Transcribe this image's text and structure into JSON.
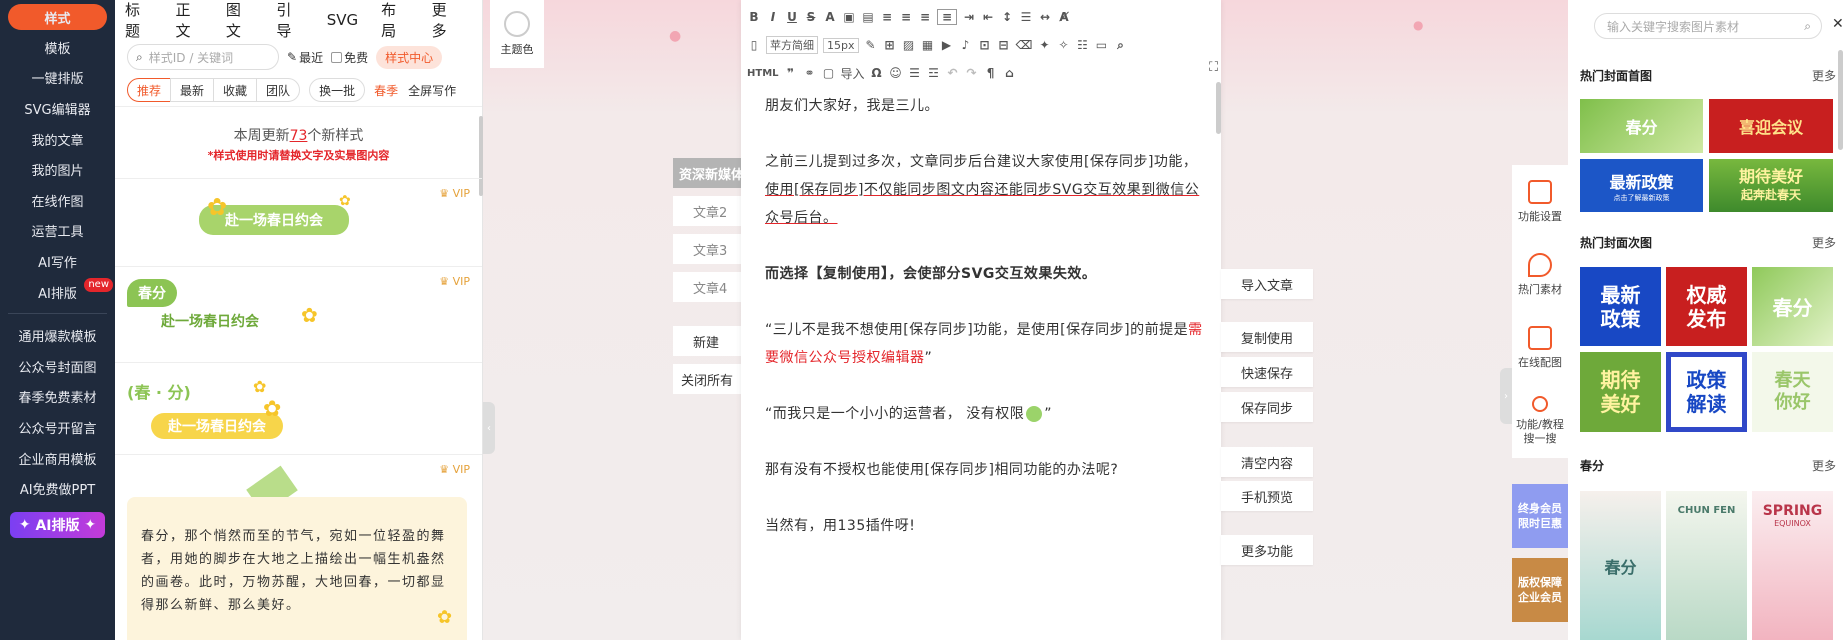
{
  "nav": {
    "items": [
      "样式",
      "模板",
      "一键排版",
      "SVG编辑器",
      "我的文章",
      "我的图片",
      "在线作图",
      "运营工具",
      "AI写作",
      "AI排版"
    ],
    "new_badge": "new",
    "items2": [
      "通用爆款模板",
      "公众号封面图",
      "春季免费素材",
      "公众号开留言",
      "企业商用模板",
      "AI免费做PPT"
    ],
    "ai_button": "AI排版"
  },
  "panel": {
    "tabs": [
      "标题",
      "正文",
      "图文",
      "引导",
      "SVG",
      "布局",
      "更多"
    ],
    "search_placeholder": "样式ID / 关键词",
    "recent": "最近",
    "free": "免费",
    "center": "样式中心",
    "filters": [
      "推荐",
      "最新",
      "收藏",
      "团队"
    ],
    "refresh": "换一批",
    "spring": "春季",
    "fullscreen": "全屏写作",
    "update_prefix": "本周更新",
    "update_count": "73",
    "update_suffix": "个新样式",
    "update_note": "*样式使用时请替换文字及实景图内容",
    "vip": "VIP",
    "card1_text": "赴一场春日约会",
    "card2_badge": "春分",
    "card2_text": "赴一场春日约会",
    "card3_title": "(春 · 分)",
    "card3_text": "赴一场春日约会",
    "card4_text": "春分，那个悄然而至的节气，宛如一位轻盈的舞者，用她的脚步在大地之上描绘出一幅生机盎然的画卷。此时，万物苏醒，大地回春，一切都显得那么新鲜、那么美好。"
  },
  "theme_label": "主题色",
  "doclist": {
    "header": "资深新媒体",
    "items": [
      "文章2",
      "文章3",
      "文章4"
    ],
    "new": "新建",
    "close_all": "关闭所有"
  },
  "toolbar": {
    "font": "苹方简细",
    "size": "15px",
    "html": "HTML",
    "import": "导入"
  },
  "content": {
    "p1": "朋友们大家好，我是三儿。",
    "p2a": "之前三儿提到过多次，文章同步后台建议大家使用[保存同步]功能，",
    "p2b": "使用[保存同步]不仅能同步图文内容还能同步SVG交互效果到微信公众号后台。",
    "p3": "而选择【复制使用】，会使部分SVG交互效果失效。",
    "p4a": "“三儿不是我不想使用[保存同步]功能，是使用[保存同步]的前提是",
    "p4b": "需要微信公众号授权编辑器",
    "p4c": "”",
    "p5": "“而我只是一个小小的运营者， 没有权限",
    "p5b": "”",
    "p6": "那有没有不授权也能使用[保存同步]相同功能的办法呢?",
    "p7": "当然有，用135插件呀!"
  },
  "actions": [
    "导入文章",
    "复制使用",
    "快速保存",
    "保存同步",
    "清空内容",
    "手机预览",
    "更多功能"
  ],
  "tools": [
    "功能设置",
    "热门素材",
    "在线配图",
    "功能/教程搜一搜"
  ],
  "promos": [
    "终身会员限时巨惠",
    "版权保障企业会员"
  ],
  "rpanel": {
    "search_placeholder": "输入关键字搜索图片素材",
    "sec1": "热门封面首图",
    "sec2": "热门封面次图",
    "sec3": "春分",
    "more": "更多",
    "covers1": [
      "春分",
      "喜迎会议",
      "最新政策",
      "期待美好"
    ],
    "covers1_sub": [
      "",
      "",
      "点击了解最新政策",
      "起奔赴春天"
    ],
    "covers2": [
      "最新政策",
      "权威发布",
      "春分",
      "期待美好",
      "政策解读",
      "春天你好"
    ],
    "posters": [
      "春分",
      "CHUN FEN",
      "SPRING"
    ],
    "poster_sub": [
      "",
      "",
      "EQUINOX"
    ]
  },
  "colors": {
    "accent": "#f15a2b",
    "nav_bg": "#1f2a3c",
    "red": "#e4262b"
  }
}
